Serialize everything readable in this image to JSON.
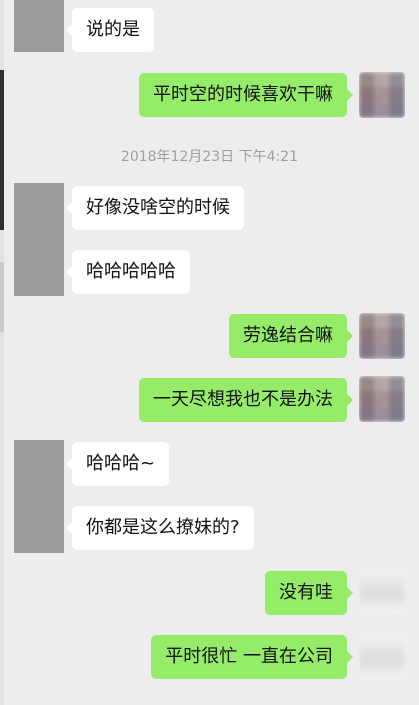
{
  "chat": {
    "timestamp": "2018年12月23日 下午4:21",
    "messages": [
      {
        "side": "in",
        "text": "说的是"
      },
      {
        "side": "out",
        "text": "平时空的时候喜欢干嘛"
      },
      {
        "side": "in",
        "text": "好像没啥空的时候"
      },
      {
        "side": "in",
        "text": "哈哈哈哈哈"
      },
      {
        "side": "out",
        "text": "劳逸结合嘛"
      },
      {
        "side": "out",
        "text": "一天尽想我也不是办法"
      },
      {
        "side": "in",
        "text": "哈哈哈~"
      },
      {
        "side": "in",
        "text": "你都是这么撩妹的?"
      },
      {
        "side": "out",
        "text": "没有哇"
      },
      {
        "side": "out",
        "text": "平时很忙 一直在公司"
      }
    ]
  },
  "colors": {
    "background": "#ededed",
    "incoming_bubble": "#ffffff",
    "outgoing_bubble": "#95ec69",
    "timestamp_text": "#9e9e9e"
  }
}
